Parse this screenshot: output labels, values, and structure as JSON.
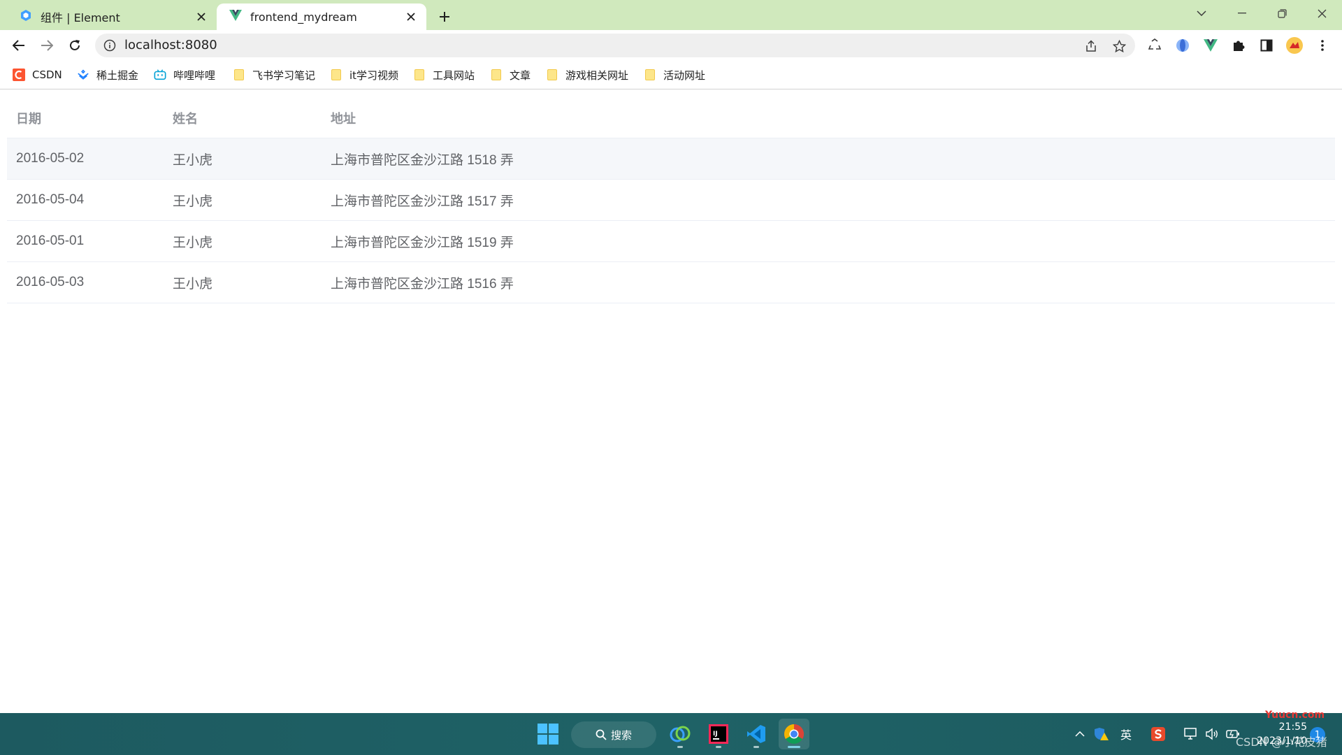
{
  "browser": {
    "tabs": [
      {
        "title": "组件 | Element",
        "active": false
      },
      {
        "title": "frontend_mydream",
        "active": true
      }
    ],
    "address": {
      "url": "localhost:8080"
    },
    "bookmarks": [
      {
        "label": "CSDN",
        "icon": "csdn-logo-icon"
      },
      {
        "label": "稀土掘金",
        "icon": "juejin-logo-icon"
      },
      {
        "label": "哔哩哔哩",
        "icon": "bilibili-logo-icon"
      },
      {
        "label": "飞书学习笔记",
        "icon": "folder-icon"
      },
      {
        "label": "it学习视频",
        "icon": "folder-icon"
      },
      {
        "label": "工具网站",
        "icon": "folder-icon"
      },
      {
        "label": "文章",
        "icon": "folder-icon"
      },
      {
        "label": "游戏相关网址",
        "icon": "folder-icon"
      },
      {
        "label": "活动网址",
        "icon": "folder-icon"
      }
    ]
  },
  "table": {
    "headers": {
      "date": "日期",
      "name": "姓名",
      "address": "地址"
    },
    "rows": [
      {
        "date": "2016-05-02",
        "name": "王小虎",
        "address": "上海市普陀区金沙江路 1518 弄"
      },
      {
        "date": "2016-05-04",
        "name": "王小虎",
        "address": "上海市普陀区金沙江路 1517 弄"
      },
      {
        "date": "2016-05-01",
        "name": "王小虎",
        "address": "上海市普陀区金沙江路 1519 弄"
      },
      {
        "date": "2016-05-03",
        "name": "王小虎",
        "address": "上海市普陀区金沙江路 1516 弄"
      }
    ]
  },
  "taskbar": {
    "search_label": "搜索",
    "ime_label": "英",
    "time": "21:55",
    "date": "2023/1/10",
    "notification_count": "1",
    "watermark": "CSDN @小花皮猪",
    "watermark_top": "Yuucn.com"
  },
  "colors": {
    "tabstrip": "#d0e9bd",
    "header_text": "#909399",
    "cell_text": "#606266",
    "stripe": "#f5f7fa",
    "taskbar": "#1f6266"
  }
}
